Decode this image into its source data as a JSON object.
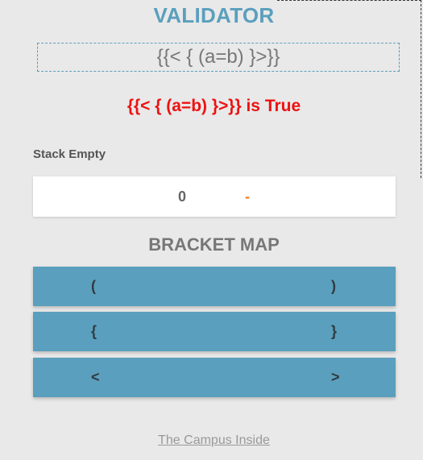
{
  "app": {
    "title": "VALIDATOR"
  },
  "expression": {
    "value": "{{< { (a=b) }>}}"
  },
  "result": {
    "text": "{{< { (a=b) }>}} is True",
    "color": "#ee1111"
  },
  "stack": {
    "label": "Stack Empty",
    "count": "0",
    "top": "-"
  },
  "bracket_map": {
    "title": "BRACKET MAP",
    "rows": [
      {
        "open": "(",
        "close": ")"
      },
      {
        "open": "{",
        "close": "}"
      },
      {
        "open": "<",
        "close": ">"
      }
    ]
  },
  "footer": {
    "link_text": "The Campus Inside"
  },
  "colors": {
    "accent": "#5a9fbd",
    "error_or_result": "#ee1111",
    "dash": "#f07a22"
  }
}
